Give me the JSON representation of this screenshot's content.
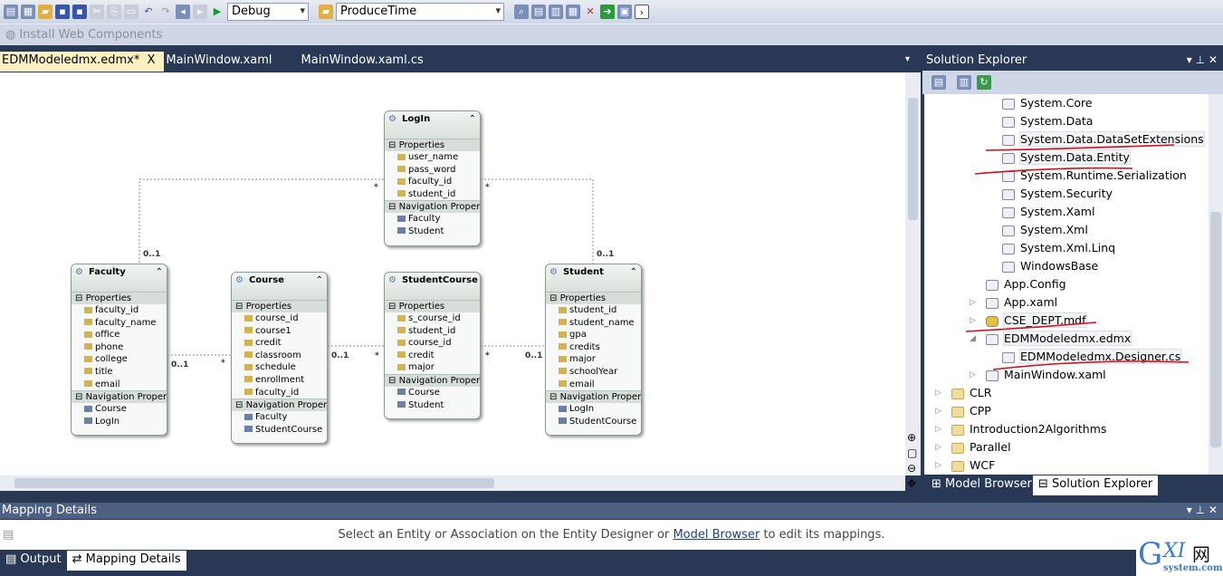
{
  "toolbar": {
    "config": "Debug",
    "startup_project": "ProduceTime",
    "install_web_components": "Install Web Components"
  },
  "doc_tabs": [
    {
      "label": "EDMModeledmx.edmx*",
      "active": true,
      "close": "X"
    },
    {
      "label": "MainWindow.xaml"
    },
    {
      "label": "MainWindow.xaml.cs"
    }
  ],
  "entities": [
    {
      "name": "LogIn",
      "props_label": "Properties",
      "props": [
        "user_name",
        "pass_word",
        "faculty_id",
        "student_id"
      ],
      "nav_label": "Navigation Proper...",
      "nav": [
        "Faculty",
        "Student"
      ]
    },
    {
      "name": "Faculty",
      "props_label": "Properties",
      "props": [
        "faculty_id",
        "faculty_name",
        "office",
        "phone",
        "college",
        "title",
        "email"
      ],
      "nav_label": "Navigation Proper...",
      "nav": [
        "Course",
        "LogIn"
      ]
    },
    {
      "name": "Course",
      "props_label": "Properties",
      "props": [
        "course_id",
        "course1",
        "credit",
        "classroom",
        "schedule",
        "enrollment",
        "faculty_id"
      ],
      "nav_label": "Navigation Proper...",
      "nav": [
        "Faculty",
        "StudentCourse"
      ]
    },
    {
      "name": "StudentCourse",
      "props_label": "Properties",
      "props": [
        "s_course_id",
        "student_id",
        "course_id",
        "credit",
        "major"
      ],
      "nav_label": "Navigation Proper...",
      "nav": [
        "Course",
        "Student"
      ]
    },
    {
      "name": "Student",
      "props_label": "Properties",
      "props": [
        "student_id",
        "student_name",
        "gpa",
        "credits",
        "major",
        "schoolYear",
        "email"
      ],
      "nav_label": "Navigation Proper...",
      "nav": [
        "LogIn",
        "StudentCourse"
      ]
    }
  ],
  "multiplicities": {
    "login_faculty": [
      "*",
      "0..1"
    ],
    "login_student": [
      "*",
      "0..1"
    ],
    "faculty_course": [
      "0..1",
      "*"
    ],
    "course_sc": [
      "0..1",
      "*"
    ],
    "sc_student": [
      "*",
      "0..1"
    ]
  },
  "solution_explorer": {
    "title": "Solution Explorer",
    "items": [
      {
        "label": "System.Core",
        "type": "ref"
      },
      {
        "label": "System.Data",
        "type": "ref"
      },
      {
        "label": "System.Data.DataSetExtensions",
        "type": "ref",
        "highlight": true
      },
      {
        "label": "System.Data.Entity",
        "type": "ref",
        "highlight": true
      },
      {
        "label": "System.Runtime.Serialization",
        "type": "ref"
      },
      {
        "label": "System.Security",
        "type": "ref"
      },
      {
        "label": "System.Xaml",
        "type": "ref"
      },
      {
        "label": "System.Xml",
        "type": "ref"
      },
      {
        "label": "System.Xml.Linq",
        "type": "ref"
      },
      {
        "label": "WindowsBase",
        "type": "ref"
      },
      {
        "label": "App.Config",
        "type": "file"
      },
      {
        "label": "App.xaml",
        "type": "file",
        "expander": "collapsed"
      },
      {
        "label": "CSE_DEPT.mdf",
        "type": "db",
        "expander": "collapsed",
        "highlight": true
      },
      {
        "label": "EDMModeledmx.edmx",
        "type": "file",
        "expander": "expanded",
        "highlight": true
      },
      {
        "label": "EDMModeledmx.Designer.cs",
        "type": "child",
        "highlight": true
      },
      {
        "label": "MainWindow.xaml",
        "type": "file",
        "expander": "collapsed"
      },
      {
        "label": "CLR",
        "type": "folder"
      },
      {
        "label": "CPP",
        "type": "folder"
      },
      {
        "label": "Introduction2Algorithms",
        "type": "folder"
      },
      {
        "label": "Parallel",
        "type": "folder"
      },
      {
        "label": "WCF",
        "type": "folder"
      }
    ],
    "tabs": [
      "Model Browser",
      "Solution Explorer"
    ]
  },
  "mapping_details": {
    "title": "Mapping Details",
    "message_before": "Select an Entity or Association on the Entity Designer or",
    "link": "Model Browser",
    "message_after": "to edit its mappings."
  },
  "bottom_tabs": [
    "Output",
    "Mapping Details"
  ],
  "annotation_color": "#d0101a",
  "watermark": "GXI网 system.com"
}
